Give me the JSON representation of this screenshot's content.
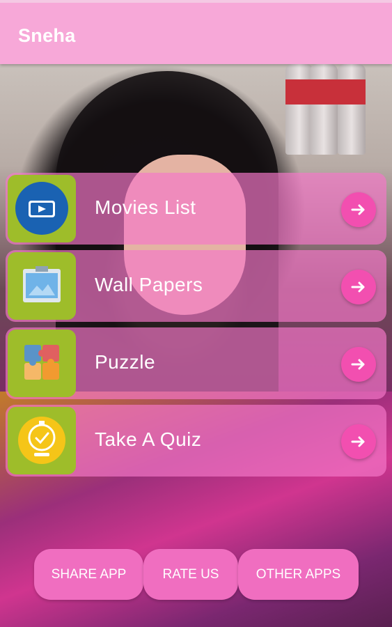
{
  "app_bar": {
    "title": "Sneha"
  },
  "menu": {
    "items": [
      {
        "label": "Movies List",
        "icon": "video-play-icon"
      },
      {
        "label": "Wall Papers",
        "icon": "wallpaper-image-icon"
      },
      {
        "label": "Puzzle",
        "icon": "puzzle-icon"
      },
      {
        "label": "Take A Quiz",
        "icon": "quiz-badge-icon"
      }
    ],
    "arrow_icon": "arrow-right-icon"
  },
  "bottom_buttons": {
    "share": "SHARE APP",
    "rate": "RATE US",
    "other": "OTHER APPS"
  },
  "colors": {
    "app_bar": "#f7a8d8",
    "card_overlay": "#f578c8",
    "arrow_button": "#f24fb0",
    "icon_tile": "#9ebd2a",
    "bottom_button": "#f06ec0"
  }
}
